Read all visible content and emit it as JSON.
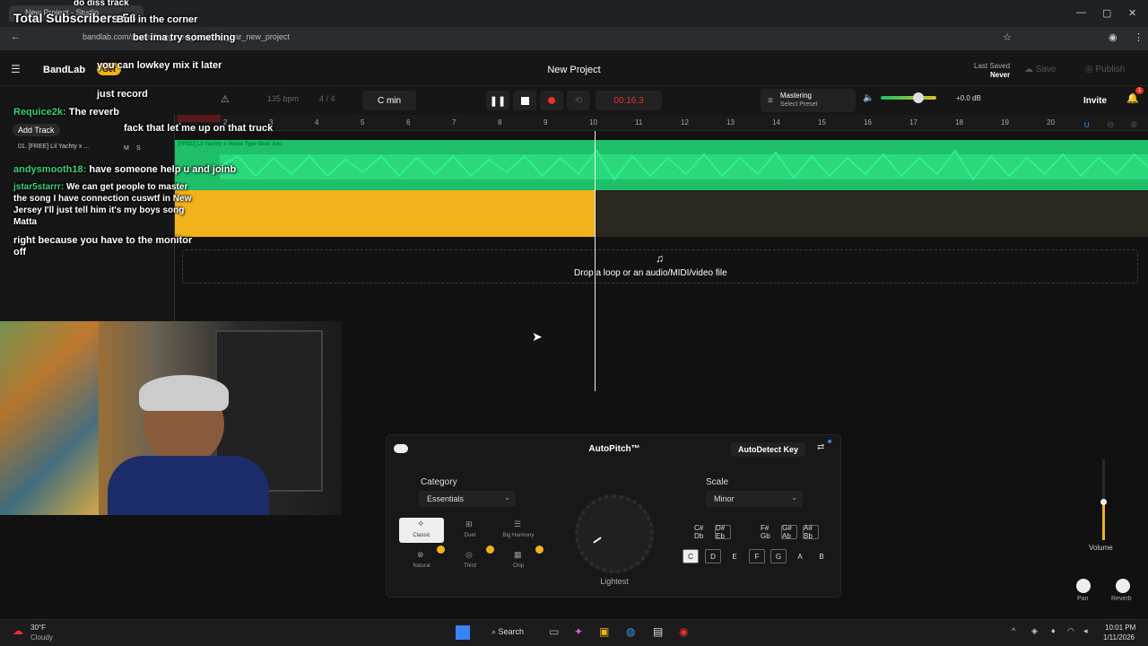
{
  "browser": {
    "tab_title": "New Project - Studio",
    "url": "bandlab.com/studio?triggered_from=top_bar_new_project",
    "window_controls": [
      "—",
      "▢",
      "✕"
    ]
  },
  "stream_overlay": {
    "subscribers": "Total Subscribers 56",
    "chat": [
      {
        "user": "",
        "text": "do diss track"
      },
      {
        "user": "",
        "text": "Bull in the corner"
      },
      {
        "user": "",
        "text": "bet ima try something"
      },
      {
        "user": "",
        "text": "you can lowkey mix it later"
      },
      {
        "user": "",
        "text": "just record"
      },
      {
        "user": "Requice2k:",
        "text": "The reverb"
      },
      {
        "user": "",
        "text": "fack that let me up on that truck"
      },
      {
        "user": "andysmooth18:",
        "text": "have someone help u and joinb"
      },
      {
        "user": "jstar5starrr:",
        "text": "We can get people to master the song I have connection cuswtf in New Jersey I'll just tell him it's my boys song Matta"
      },
      {
        "user": "",
        "text": "right because you have to the monitor off"
      }
    ]
  },
  "app": {
    "brand": "BandLab",
    "get_label": "Get",
    "project_title": "New Project",
    "last_saved_label": "Last Saved",
    "last_saved_value": "Never",
    "save_label": "Save",
    "publish_label": "Publish",
    "invite_label": "Invite",
    "notification_count": "1"
  },
  "transport": {
    "bpm": "135 bpm",
    "time_signature": "4 / 4",
    "key": "C min",
    "time": "00:16.3",
    "mastering_label": "Mastering",
    "mastering_preset": "Select Preset",
    "master_gain": "+0.0 dB"
  },
  "timeline": {
    "bars": [
      "1",
      "2",
      "3",
      "4",
      "5",
      "6",
      "7",
      "8",
      "9",
      "10",
      "11",
      "12",
      "13",
      "14",
      "15",
      "16",
      "17",
      "18",
      "19",
      "20"
    ],
    "add_track": "Add Track",
    "track1_name": "01. [FREE] Lil Yachty x ...",
    "region_name": "[FREE] Lil Yachty x Veeze Type Beat Juic",
    "track_m": "M",
    "track_s": "S",
    "drop_text": "Drop a loop or an audio/MIDI/video file"
  },
  "autopitch": {
    "title": "AutoPitch™",
    "autodetect": "AutoDetect Key",
    "category_label": "Category",
    "category_value": "Essentials",
    "scale_label": "Scale",
    "scale_value": "Minor",
    "effects": [
      {
        "name": "Classic"
      },
      {
        "name": "Duet"
      },
      {
        "name": "Big Harmony"
      },
      {
        "name": "Natural"
      },
      {
        "name": "Third"
      },
      {
        "name": "Chip"
      }
    ],
    "knob_label": "Lightest",
    "sharp_keys": [
      "C# Db",
      "D# Eb",
      "F# Gb",
      "G# Ab",
      "A# Bb"
    ],
    "natural_keys": [
      "C",
      "D",
      "E",
      "F",
      "G",
      "A",
      "B"
    ]
  },
  "mixer": {
    "volume_label": "Volume",
    "pan_label": "Pan",
    "reverb_label": "Reverb"
  },
  "taskbar": {
    "weather_temp": "30°F",
    "weather_desc": "Cloudy",
    "search": "Search",
    "time": "10:01 PM",
    "date": "1/11/2026"
  },
  "colors": {
    "waveform": "#1fbf6a",
    "region_orange": "#f2b21b",
    "record": "#e5322d",
    "accent_blue": "#3a82f7"
  }
}
